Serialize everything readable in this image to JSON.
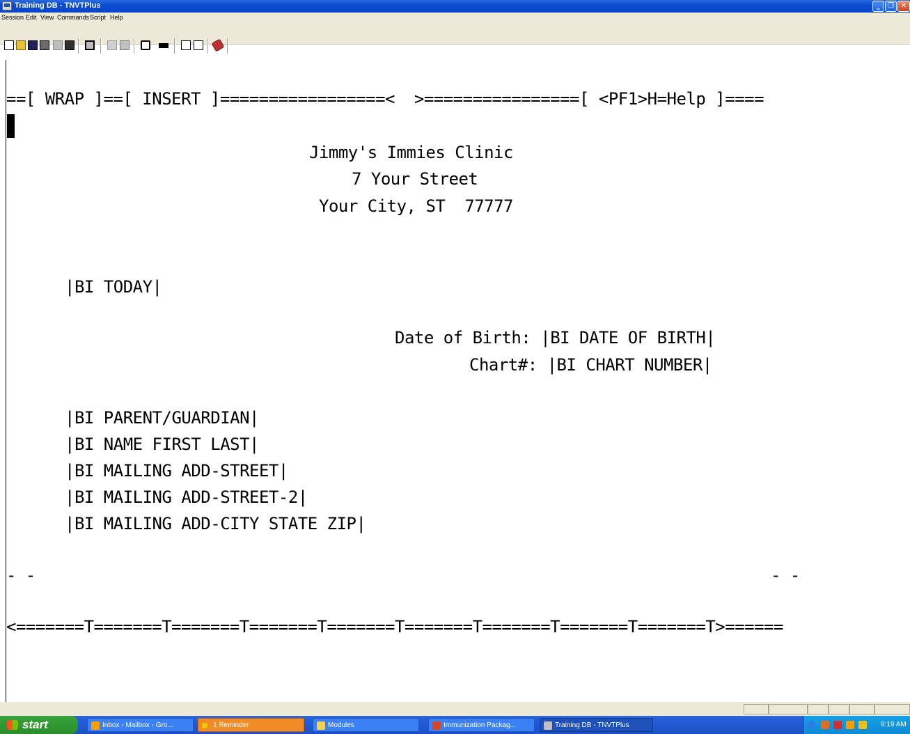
{
  "window": {
    "title": "Training DB - TNVTPlus"
  },
  "menu": {
    "items": [
      "Session",
      "Edit",
      "View",
      "Commands",
      "Script",
      "Help"
    ]
  },
  "toolbar": {
    "buttons": [
      "new-icon",
      "open-icon",
      "save-icon",
      "properties-icon",
      "disconnect-icon",
      "connect-icon",
      "print-icon",
      "copy-icon",
      "paste-icon",
      "blank-screen-icon",
      "screen-icon",
      "send-file-icon",
      "receive-file-icon",
      "macro-icon"
    ]
  },
  "terminal": {
    "status_line": "==[ WRAP ]==[ INSERT ]=================<  >================[ <PF1>H=Help ]====",
    "clinic_name": "Jimmy's Immies Clinic",
    "clinic_street": "7 Your Street",
    "clinic_city": "Your City, ST  77777",
    "today_field": "|BI TODAY|",
    "dob_line": "Date of Birth: |BI DATE OF BIRTH|",
    "chart_line": "Chart#: |BI CHART NUMBER|",
    "address_fields": [
      "|BI PARENT/GUARDIAN|",
      "|BI NAME FIRST LAST|",
      "|BI MAILING ADD-STREET|",
      "|BI MAILING ADD-STREET-2|",
      "|BI MAILING ADD-CITY STATE ZIP|"
    ],
    "page_marker_left": "- -",
    "page_marker_right": "- -",
    "ruler": "<=======T=======T=======T=======T=======T=======T=======T=======T=======T>======"
  },
  "taskbar": {
    "start_label": "start",
    "tasks": [
      {
        "label": "Inbox - Mailbox - Gro...",
        "icon": "outlook-icon",
        "color": "#f5a000"
      },
      {
        "label": "1 Reminder",
        "icon": "reminder-icon",
        "color": "#f5c400"
      },
      {
        "label": "Modules",
        "icon": "folder-icon",
        "color": "#f2cf55"
      },
      {
        "label": "Immunization Packag...",
        "icon": "powerpoint-icon",
        "color": "#d24726"
      },
      {
        "label": "Training DB - TNVTPlus",
        "icon": "terminal-icon",
        "color": "#c0c0c0"
      }
    ],
    "clock": "9:19 AM"
  }
}
